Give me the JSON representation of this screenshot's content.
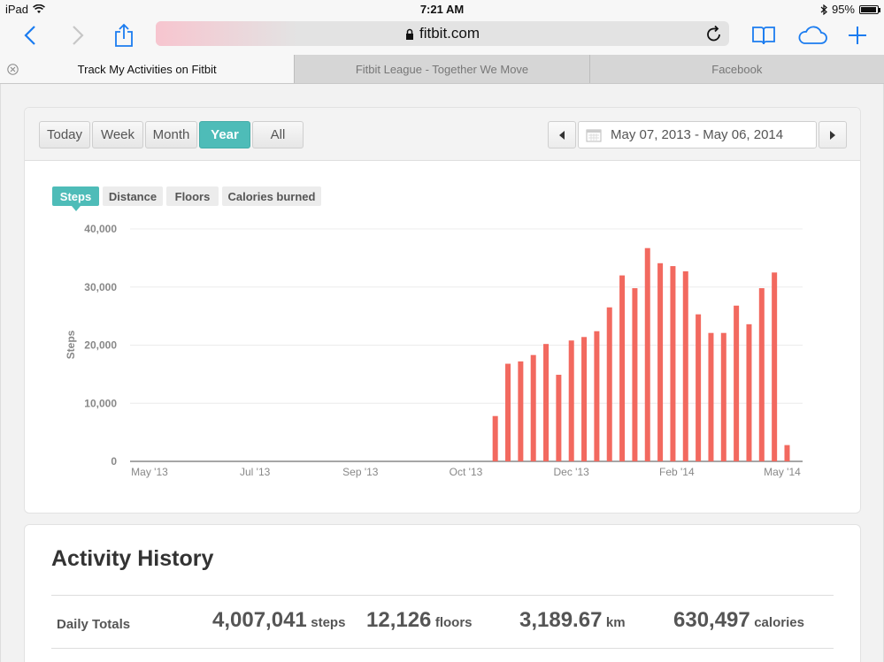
{
  "status_bar": {
    "device": "iPad",
    "time": "7:21 AM",
    "battery": "95%",
    "battery_level": 0.95
  },
  "browser": {
    "url": "fitbit.com",
    "tabs": [
      {
        "label": "Track My Activities on Fitbit",
        "active": true
      },
      {
        "label": "Fitbit League - Together We Move",
        "active": false
      },
      {
        "label": "Facebook",
        "active": false
      }
    ]
  },
  "period_buttons": [
    {
      "label": "Today",
      "active": false
    },
    {
      "label": "Week",
      "active": false
    },
    {
      "label": "Month",
      "active": false
    },
    {
      "label": "Year",
      "active": true
    },
    {
      "label": "All",
      "active": false
    }
  ],
  "date_range": "May 07, 2013 - May 06, 2014",
  "metric_tabs": [
    {
      "label": "Steps",
      "active": true
    },
    {
      "label": "Distance",
      "active": false
    },
    {
      "label": "Floors",
      "active": false
    },
    {
      "label": "Calories burned",
      "active": false
    }
  ],
  "chart_data": {
    "type": "bar",
    "ylabel": "Steps",
    "ylim": [
      0,
      40000
    ],
    "yticks": [
      "0",
      "10,000",
      "20,000",
      "30,000",
      "40,000"
    ],
    "xlabels": [
      "May '13",
      "Jul '13",
      "Sep '13",
      "Oct '13",
      "Dec '13",
      "Feb '14",
      "May '14"
    ],
    "grid": true,
    "bar_color": "#f2695f",
    "series": [
      {
        "week_index": [
          28,
          29,
          30,
          31,
          32,
          33,
          34,
          35,
          36,
          37,
          38,
          39,
          40,
          41,
          42,
          43,
          44,
          45,
          46,
          47,
          48,
          49,
          50,
          51,
          52
        ],
        "values": [
          7800,
          16800,
          17200,
          18300,
          20200,
          14900,
          20800,
          21400,
          22400,
          26500,
          32000,
          29800,
          36700,
          34100,
          33600,
          32700,
          25300,
          22100,
          22100,
          26800,
          23600,
          29800,
          32500,
          2800,
          0
        ]
      }
    ]
  },
  "activity_history": {
    "title": "Activity History",
    "daily_totals_label": "Daily Totals",
    "totals": [
      {
        "value": "4,007,041",
        "unit": "steps"
      },
      {
        "value": "12,126",
        "unit": "floors"
      },
      {
        "value": "3,189.67",
        "unit": "km"
      },
      {
        "value": "630,497",
        "unit": "calories"
      }
    ]
  }
}
